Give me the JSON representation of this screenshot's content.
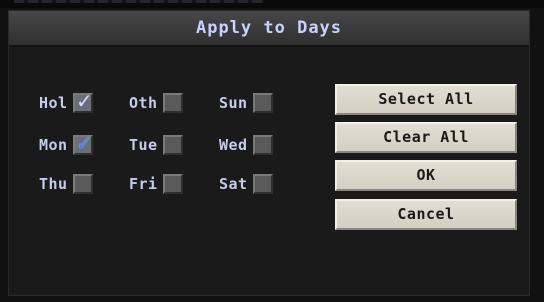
{
  "dialog": {
    "title": "Apply to Days"
  },
  "days": [
    {
      "label": "Hol",
      "checked": true
    },
    {
      "label": "Oth",
      "checked": false
    },
    {
      "label": "Sun",
      "checked": false
    },
    {
      "label": "Mon",
      "checked": true
    },
    {
      "label": "Tue",
      "checked": false
    },
    {
      "label": "Wed",
      "checked": false
    },
    {
      "label": "Thu",
      "checked": false
    },
    {
      "label": "Fri",
      "checked": false
    },
    {
      "label": "Sat",
      "checked": false
    }
  ],
  "buttons": {
    "select_all": "Select All",
    "clear_all": "Clear All",
    "ok": "OK",
    "cancel": "Cancel"
  },
  "icons": {
    "check": "✓"
  }
}
